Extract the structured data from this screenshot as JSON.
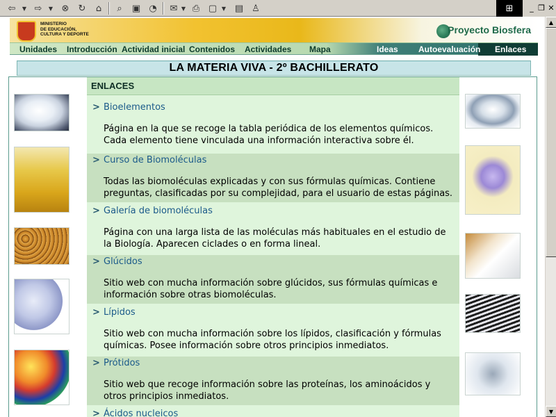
{
  "toolbar": {
    "icons": [
      "back-icon",
      "forward-icon",
      "stop-icon",
      "refresh-icon",
      "home-icon",
      "search-icon",
      "favorites-icon",
      "history-icon",
      "mail-icon",
      "print-icon",
      "edit-icon",
      "page-icon",
      "messenger-icon"
    ]
  },
  "header": {
    "ministry_text": "MINISTERIO\nDE EDUCACIÓN,\nCULTURA Y DEPORTE",
    "brand": "Proyecto Biosfera"
  },
  "nav": {
    "items": [
      "Unidades",
      "Introducción",
      "Actividad inicial",
      "Contenidos",
      "Actividades",
      "Mapa",
      "Ideas",
      "Autoevaluación",
      "Enlaces"
    ]
  },
  "page": {
    "title": "LA MATERIA VIVA - 2º BACHILLERATO",
    "section": "ENLACES"
  },
  "entries": [
    {
      "title": "Bioelementos",
      "desc": "Página en la que se recoge la tabla periódica de los elementos químicos. Cada elemento tiene vinculada una información interactiva sobre él."
    },
    {
      "title": "Curso de Biomoléculas",
      "desc": "Todas las biomoléculas explicadas y con sus fórmulas químicas. Contiene preguntas, clasificadas por su complejidad, para el usuario de estas páginas."
    },
    {
      "title": "Galería de biomoléculas",
      "desc": "Página con una larga lista de las moléculas más habituales en el estudio de la Biología. Aparecen ciclades o en forma lineal."
    },
    {
      "title": "Glúcidos",
      "desc": "Sitio web con mucha información sobre glúcidos, sus fórmulas químicas e información sobre otras biomoléculas."
    },
    {
      "title": "Lípidos",
      "desc": "Sitio web con mucha información sobre los lípidos, clasificación y fórmulas químicas. Posee información sobre otros principios inmediatos."
    },
    {
      "title": "Prótidos",
      "desc": "Sitio web que recoge información sobre las proteínas, los aminoácidos y otros principios inmediatos."
    },
    {
      "title": "Ácidos nucleicos",
      "desc": ""
    }
  ]
}
